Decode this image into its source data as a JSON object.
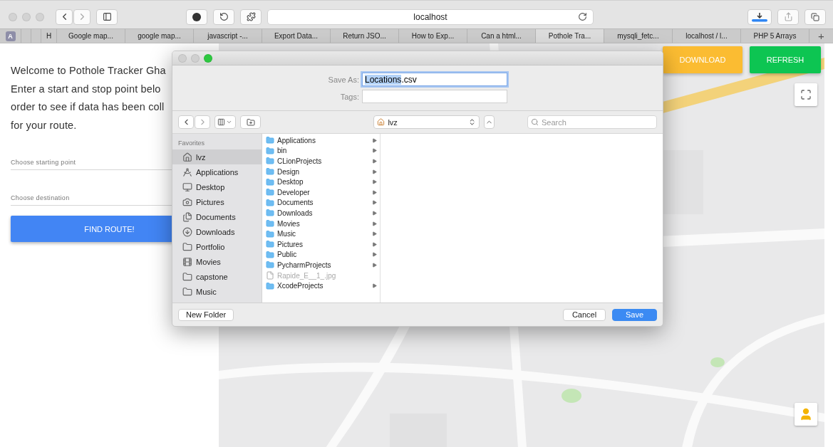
{
  "browser": {
    "address": "localhost",
    "tabs": [
      {
        "label": "A",
        "kind": "pinned",
        "selected": false
      },
      {
        "label": "H",
        "kind": "page",
        "selected": false
      },
      {
        "label": "Google map...",
        "kind": "page",
        "selected": false
      },
      {
        "label": "google map...",
        "kind": "page",
        "selected": false
      },
      {
        "label": "javascript -...",
        "kind": "page",
        "selected": false
      },
      {
        "label": "Export Data...",
        "kind": "page",
        "selected": false
      },
      {
        "label": "Return JSO...",
        "kind": "page",
        "selected": false
      },
      {
        "label": "How to Exp...",
        "kind": "page",
        "selected": false
      },
      {
        "label": "Can a html...",
        "kind": "page",
        "selected": false
      },
      {
        "label": "Pothole Tra...",
        "kind": "page",
        "selected": true
      },
      {
        "label": "mysqli_fetc...",
        "kind": "page",
        "selected": false
      },
      {
        "label": "localhost / l...",
        "kind": "page",
        "selected": false
      },
      {
        "label": "PHP 5 Arrays",
        "kind": "page",
        "selected": false
      }
    ],
    "new_tab": "+"
  },
  "page": {
    "intro": [
      "Welcome to Pothole Tracker Gha",
      "Enter a start and stop point belo",
      "order to see if data has been coll",
      "for your route."
    ],
    "start_field": {
      "placeholder": "Choose starting point"
    },
    "destination_field": {
      "placeholder": "Choose destination"
    },
    "find_button": "FIND ROUTE!",
    "map": {
      "kind": "picture",
      "download_button": "DOWNLOAD",
      "refresh_button": "REFRESH"
    }
  },
  "dialog": {
    "save_as_label": "Save As:",
    "filename": "Locations.csv",
    "filename_selected": true,
    "tags_label": "Tags:",
    "location": "lvz",
    "search": {
      "placeholder": "Search"
    },
    "sidebar": {
      "heading": "Favorites",
      "items": [
        {
          "label": "lvz",
          "kind": "home",
          "selected": true
        },
        {
          "label": "Applications",
          "kind": "apps",
          "selected": false
        },
        {
          "label": "Desktop",
          "kind": "desktop",
          "selected": false
        },
        {
          "label": "Pictures",
          "kind": "pictures",
          "selected": false
        },
        {
          "label": "Documents",
          "kind": "documents",
          "selected": false
        },
        {
          "label": "Downloads",
          "kind": "downloads",
          "selected": false
        },
        {
          "label": "Portfolio",
          "kind": "folder",
          "selected": false
        },
        {
          "label": "Movies",
          "kind": "movies",
          "selected": false
        },
        {
          "label": "capstone",
          "kind": "folder",
          "selected": false
        },
        {
          "label": "Music",
          "kind": "folder",
          "selected": false
        }
      ]
    },
    "files": [
      {
        "name": "Applications",
        "kind": "folder",
        "disabled": false
      },
      {
        "name": "bin",
        "kind": "folder",
        "disabled": false
      },
      {
        "name": "CLionProjects",
        "kind": "folder",
        "disabled": false
      },
      {
        "name": "Design",
        "kind": "folder",
        "disabled": false
      },
      {
        "name": "Desktop",
        "kind": "folder",
        "disabled": false
      },
      {
        "name": "Developer",
        "kind": "folder",
        "disabled": false
      },
      {
        "name": "Documents",
        "kind": "folder",
        "disabled": false
      },
      {
        "name": "Downloads",
        "kind": "folder",
        "disabled": false
      },
      {
        "name": "Movies",
        "kind": "folder",
        "disabled": false
      },
      {
        "name": "Music",
        "kind": "folder",
        "disabled": false
      },
      {
        "name": "Pictures",
        "kind": "folder",
        "disabled": false
      },
      {
        "name": "Public",
        "kind": "folder",
        "disabled": false
      },
      {
        "name": "PycharmProjects",
        "kind": "folder",
        "disabled": false
      },
      {
        "name": "Rapide_E__1_.jpg",
        "kind": "file",
        "disabled": true
      },
      {
        "name": "XcodeProjects",
        "kind": "folder",
        "disabled": false
      }
    ],
    "buttons": {
      "new_folder": "New Folder",
      "cancel": "Cancel",
      "save": "Save"
    }
  }
}
